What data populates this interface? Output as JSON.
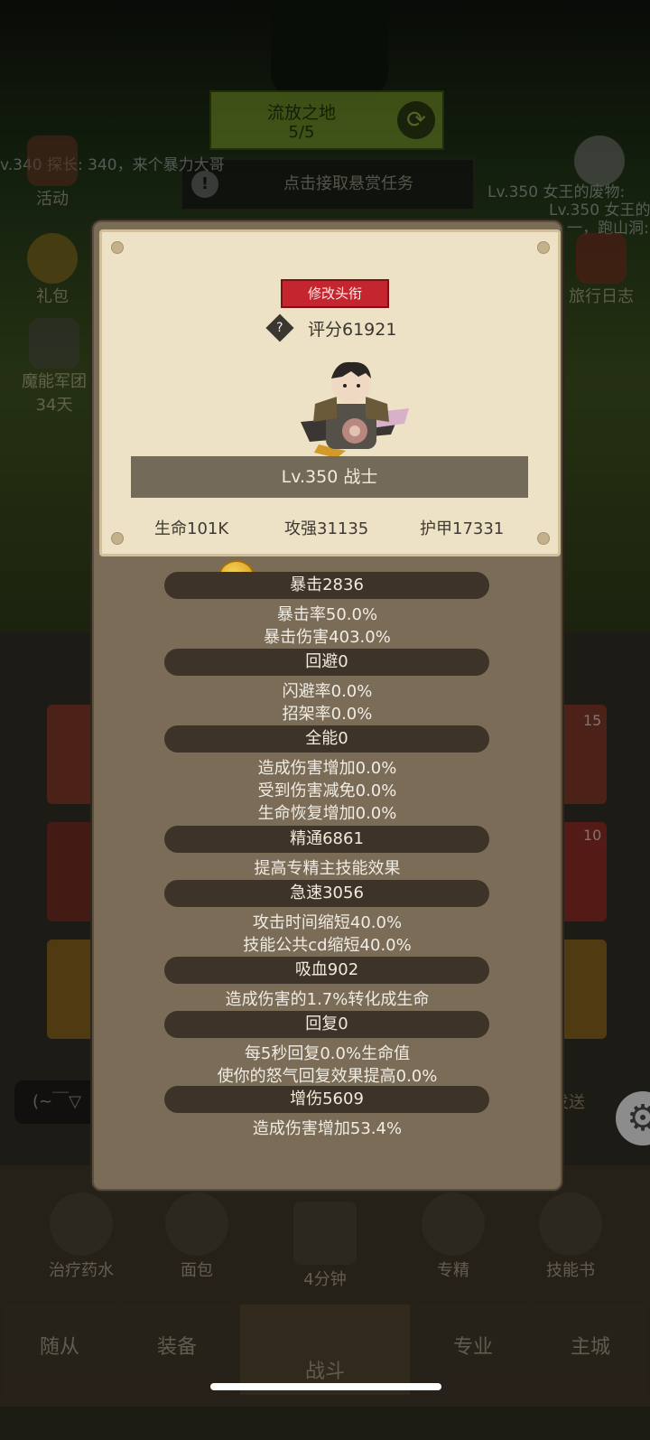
{
  "background": {
    "region_name": "流放之地",
    "region_progress": "5/5",
    "bounty_text": "点击接取悬赏任务",
    "chat_left": "v.340 探长: 340，来个暴力大哥",
    "chat_right_1": "Lv.350 女王的废物:",
    "chat_right_2": "Lv.350 女王的",
    "chat_right_3": "一，跑山洞:",
    "side_left": [
      {
        "label": "活动"
      },
      {
        "label": "礼包"
      },
      {
        "label": "魔能军团",
        "sub": "34天"
      }
    ],
    "side_right": [
      {
        "label": "旅行日志"
      }
    ],
    "card_counts": [
      "15",
      "10"
    ],
    "chat_input_placeholder": "(~￣▽",
    "send_label": "发送",
    "bottom_items": [
      {
        "label": "治疗药水"
      },
      {
        "label": "面包"
      },
      {
        "label": "4分钟"
      },
      {
        "label": "专精"
      },
      {
        "label": "技能书"
      }
    ],
    "nav": [
      "随从",
      "装备",
      "战斗",
      "专业",
      "主城"
    ]
  },
  "profile": {
    "edit_title_label": "修改头衔",
    "score_label": "评分61921",
    "level_class": "Lv.350 战士",
    "hp": "生命101K",
    "attack": "攻强31135",
    "armor": "护甲17331"
  },
  "stats": [
    {
      "header": "暴击2836",
      "lines": [
        "暴击率50.0%",
        "暴击伤害403.0%"
      ]
    },
    {
      "header": "回避0",
      "lines": [
        "闪避率0.0%",
        "招架率0.0%"
      ]
    },
    {
      "header": "全能0",
      "lines": [
        "造成伤害增加0.0%",
        "受到伤害减免0.0%",
        "生命恢复增加0.0%"
      ]
    },
    {
      "header": "精通6861",
      "lines": [
        "提高专精主技能效果"
      ]
    },
    {
      "header": "急速3056",
      "lines": [
        "攻击时间缩短40.0%",
        "技能公共cd缩短40.0%"
      ]
    },
    {
      "header": "吸血902",
      "lines": [
        "造成伤害的1.7%转化成生命"
      ]
    },
    {
      "header": "回复0",
      "lines": [
        "每5秒回复0.0%生命值",
        "使你的怒气回复效果提高0.0%"
      ]
    },
    {
      "header": "增伤5609",
      "lines": [
        "造成伤害增加53.4%"
      ]
    }
  ],
  "colors": {
    "title_button": "#c5252f",
    "parchment": "#eee2c6",
    "modal": "#7a6c57",
    "stat_header": "#3d3328"
  }
}
